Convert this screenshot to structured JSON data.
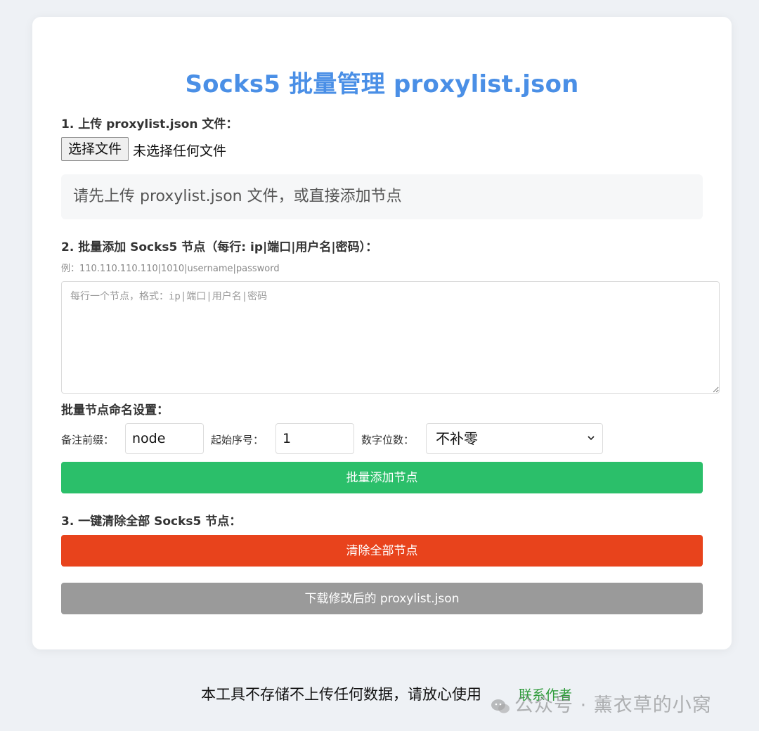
{
  "header": {
    "title": "Socks5 批量管理 proxylist.json"
  },
  "upload": {
    "label": "1. 上传 proxylist.json 文件：",
    "choose_button": "选择文件",
    "no_file_text": "未选择任何文件",
    "status": "请先上传 proxylist.json 文件，或直接添加节点"
  },
  "batch": {
    "label": "2. 批量添加 Socks5 节点（每行: ip|端口|用户名|密码）：",
    "example": "例：110.110.110.110|1010|username|password",
    "textarea_placeholder": "每行一个节点，格式：ip|端口|用户名|密码"
  },
  "naming": {
    "label": "批量节点命名设置：",
    "prefix_label": "备注前缀：",
    "prefix_value": "node",
    "start_label": "起始序号：",
    "start_value": "1",
    "digits_label": "数字位数：",
    "digits_selected": "不补零",
    "add_button": "批量添加节点"
  },
  "clear": {
    "label": "3. 一键清除全部 Socks5 节点：",
    "clear_button": "清除全部节点",
    "download_button": "下载修改后的 proxylist.json"
  },
  "footer": {
    "text": "本工具不存储不上传任何数据，请放心使用",
    "contact_link": "联系作者",
    "watermark": "公众号 · 薰衣草的小窝"
  },
  "colors": {
    "title": "#4a8fe6",
    "add_button": "#2bbf6a",
    "clear_button": "#e8431c",
    "download_button": "#9a9a9a"
  },
  "icons": {
    "select": "chevron-down-icon",
    "watermark": "wechat-icon"
  }
}
